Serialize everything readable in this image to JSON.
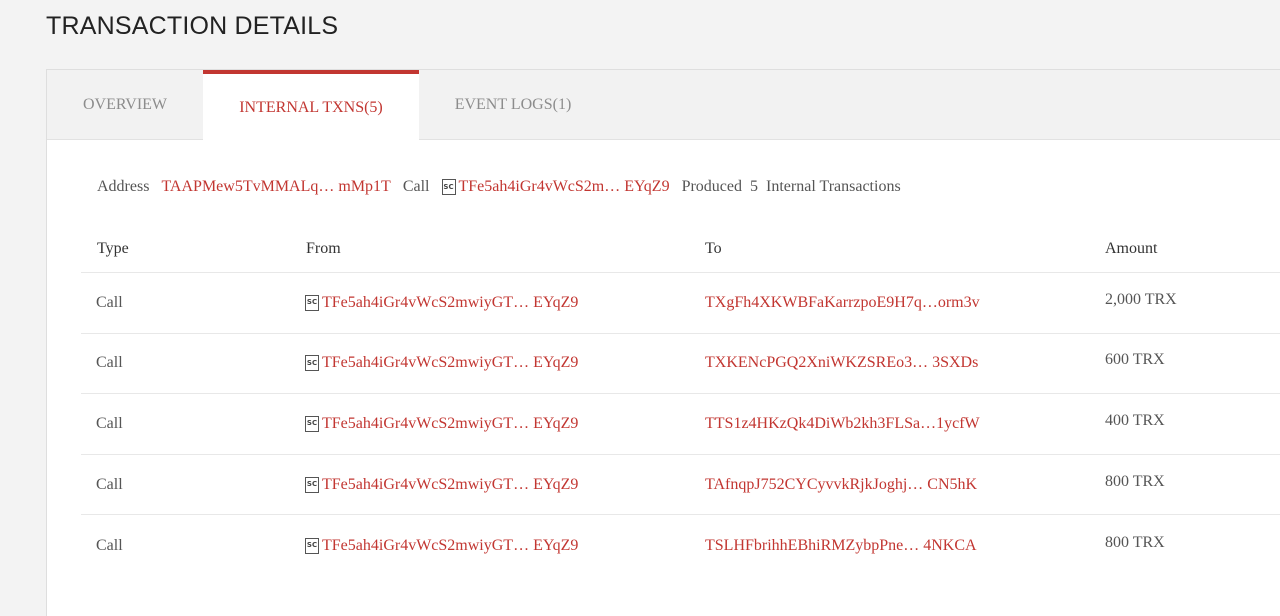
{
  "page_title": "TRANSACTION DETAILS",
  "tabs": [
    {
      "label": "OVERVIEW",
      "active": false
    },
    {
      "label": "INTERNAL TXNS(5)",
      "active": true
    },
    {
      "label": "EVENT LOGS(1)",
      "active": false
    }
  ],
  "summary": {
    "address_label": "Address",
    "address_value": "TAAPMew5TvMMALq… mMp1T",
    "call_label": "Call",
    "contract_badge": "SC",
    "contract_value": "TFe5ah4iGr4vWcS2m… EYqZ9",
    "produced_label": "Produced",
    "produced_count": "5",
    "produced_suffix": "Internal Transactions"
  },
  "table": {
    "headers": {
      "type": "Type",
      "from": "From",
      "to": "To",
      "amount": "Amount"
    },
    "rows": [
      {
        "type": "Call",
        "from": "TFe5ah4iGr4vWcS2mwiyGT… EYqZ9",
        "to": "TXgFh4XKWBFaKarrzpoE9H7q…orm3v",
        "amount": "2,000 TRX"
      },
      {
        "type": "Call",
        "from": "TFe5ah4iGr4vWcS2mwiyGT… EYqZ9",
        "to": "TXKENcPGQ2XniWKZSREo3… 3SXDs",
        "amount": "600 TRX"
      },
      {
        "type": "Call",
        "from": "TFe5ah4iGr4vWcS2mwiyGT… EYqZ9",
        "to": "TTS1z4HKzQk4DiWb2kh3FLSa…1ycfW",
        "amount": "400 TRX"
      },
      {
        "type": "Call",
        "from": "TFe5ah4iGr4vWcS2mwiyGT… EYqZ9",
        "to": "TAfnqpJ752CYCyvvkRjkJoghj… CN5hK",
        "amount": "800 TRX"
      },
      {
        "type": "Call",
        "from": "TFe5ah4iGr4vWcS2mwiyGT… EYqZ9",
        "to": "TSLHFbrihhEBhiRMZybpPne… 4NKCA",
        "amount": "800 TRX"
      }
    ]
  },
  "colors": {
    "accent": "#c23631",
    "text": "#333333",
    "muted": "#8c8c8c"
  }
}
